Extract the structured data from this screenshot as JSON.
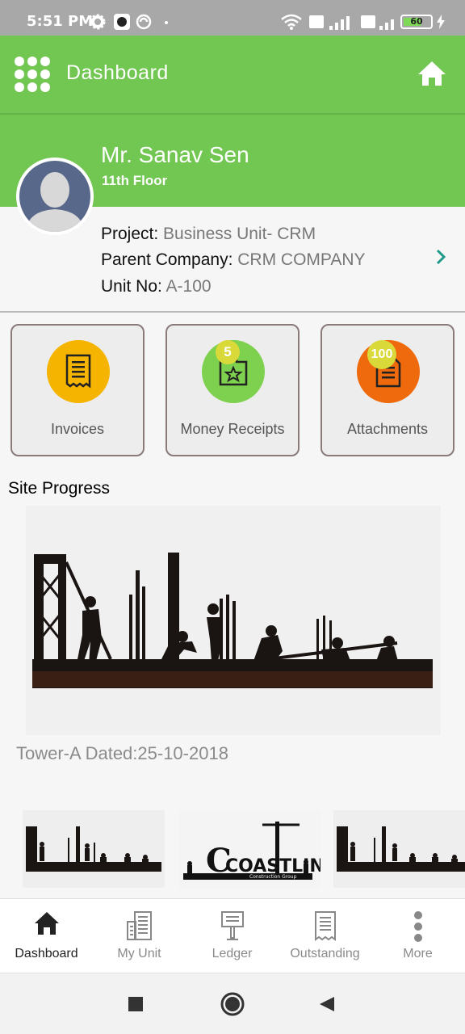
{
  "status_bar": {
    "time": "5:51 PM",
    "battery": "60",
    "icons": [
      "gear-icon",
      "app-icon",
      "sync-icon",
      "wifi-icon",
      "volte-icon",
      "signal-icon",
      "charging-icon"
    ]
  },
  "app_bar": {
    "title": "Dashboard",
    "menu_icon": "grid-menu-icon",
    "home_icon": "home-icon"
  },
  "profile": {
    "name": "Mr. Sanav Sen",
    "floor": "11th Floor",
    "project_label": "Project:",
    "project_value": "Business Unit- CRM",
    "company_label": "Parent Company:",
    "company_value": "CRM COMPANY",
    "unit_label": "Unit No:",
    "unit_value": "A-100"
  },
  "actions": [
    {
      "label": "Invoices",
      "icon": "invoice-icon",
      "color": "#f4b400",
      "badge": ""
    },
    {
      "label": "Money Receipts",
      "icon": "receipt-star-icon",
      "color": "#7ed14e",
      "badge": "5"
    },
    {
      "label": "Attachments",
      "icon": "document-icon",
      "color": "#ee6a0c",
      "badge": "100"
    }
  ],
  "site_progress": {
    "title": "Site Progress",
    "caption": "Tower-A Dated:25-10-2018",
    "logo_text": "COASTLINE",
    "logo_subtext": "Construction Group"
  },
  "bottom_nav": [
    {
      "label": "Dashboard",
      "icon": "home-icon",
      "active": true
    },
    {
      "label": "My Unit",
      "icon": "building-icon",
      "active": false
    },
    {
      "label": "Ledger",
      "icon": "ledger-icon",
      "active": false
    },
    {
      "label": "Outstanding",
      "icon": "outstanding-icon",
      "active": false
    },
    {
      "label": "More",
      "icon": "more-vertical-icon",
      "active": false
    }
  ],
  "colors": {
    "brand_green": "#72c652",
    "nav_active": "#222222",
    "nav_inactive": "#8a8a8a"
  }
}
